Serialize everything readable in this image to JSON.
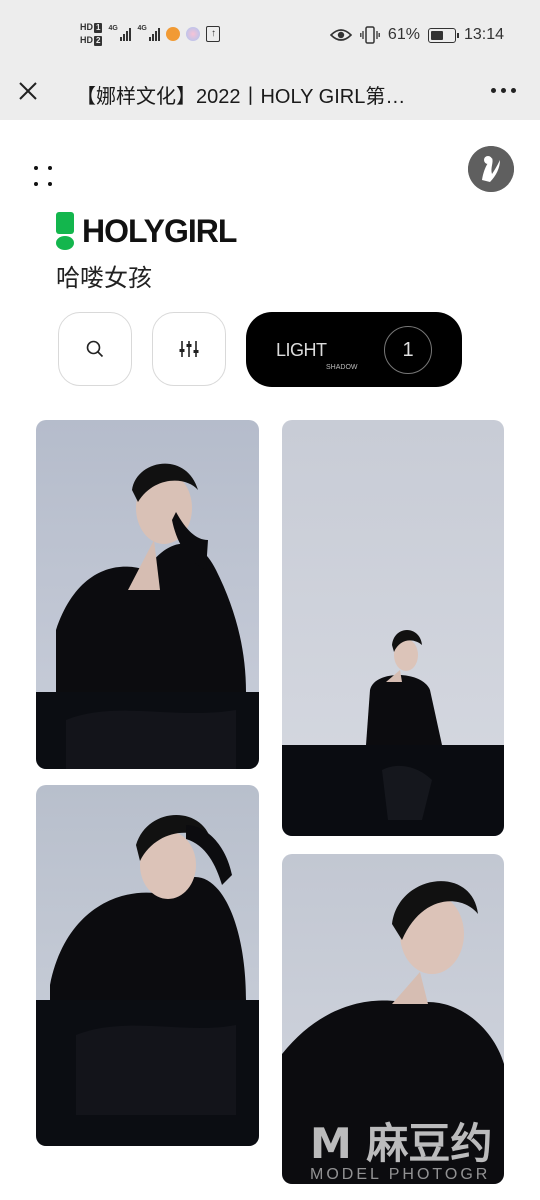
{
  "status_bar": {
    "hd1": "HD",
    "hd1_num": "1",
    "hd2": "HD",
    "hd2_num": "2",
    "net1": "4G",
    "net2": "4G",
    "battery_text": "61%",
    "battery_level": 0.61,
    "time": "13:14"
  },
  "nav": {
    "title": "【娜样文化】2022丨HOLY GIRL第…"
  },
  "brand": {
    "logo_text": "HOLYGIRL",
    "subtitle": "哈喽女孩",
    "accent_color": "#13b64d"
  },
  "controls": {
    "mode_label": "LIGHT",
    "mode_sublabel": "SHADOW",
    "mode_count": "1"
  },
  "watermark": {
    "main": "M 麻豆约",
    "sub": "MODEL PHOTOGR"
  },
  "icons": {
    "close": "close-icon",
    "more": "more-icon",
    "search": "search-icon",
    "filter": "sliders-icon",
    "grid": "dots-grid-icon"
  }
}
